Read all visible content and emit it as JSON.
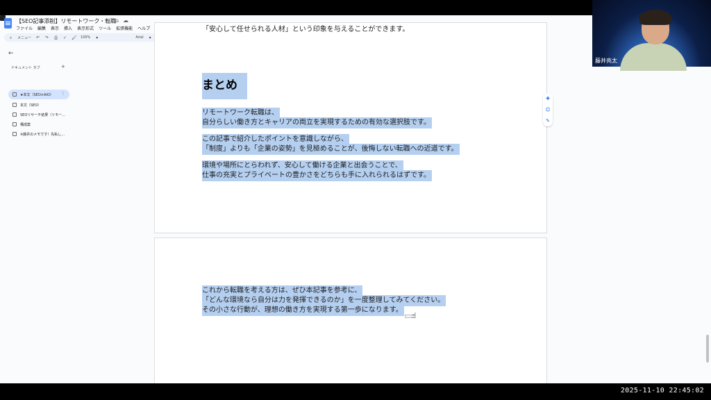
{
  "window": {
    "title": "【SEO記事添削】リモートワーク・転職",
    "menu": [
      "ファイル",
      "編集",
      "表示",
      "挿入",
      "表示形式",
      "ツール",
      "拡張機能",
      "ヘルプ"
    ]
  },
  "toolbar": {
    "menu_search": "メニュー",
    "zoom": "100%",
    "font": "Arial"
  },
  "sidebar": {
    "heading": "ドキュメント タブ",
    "add_tab": "+",
    "tabs": [
      {
        "label": "★本文（SEO×AIO）",
        "active": true
      },
      {
        "label": "本文（SEO）",
        "active": false
      },
      {
        "label": "SEOリサーチ結果（リモー…",
        "active": false
      },
      {
        "label": "構成案",
        "active": false
      },
      {
        "label": "※藤井のメモです！先私し…",
        "active": false
      }
    ]
  },
  "document": {
    "partial_line": "「安心して任せられる人材」という印象を与えることができます。",
    "heading": "まとめ",
    "page1_paragraphs": [
      [
        "リモートワーク転職は、",
        "自分らしい働き方とキャリアの両立を実現するための有効な選択肢です。"
      ],
      [
        "この記事で紹介したポイントを意識しながら、",
        "「制度」よりも「企業の姿勢」を見極めることが、後悔しない転職への近道です。"
      ],
      [
        "環境や場所にとらわれず、安心して働ける企業と出会うことで、",
        "仕事の充実とプライベートの豊かさをどちらも手に入れられるはずです。"
      ]
    ],
    "page2_lines": [
      "これから転職を考える方は、ぜひ本記事を参考に、",
      "「どんな環境なら自分は力を発揮できるのか」を一度整理してみてください。",
      "その小さな行動が、理想の働き方を実現する第一歩になります。"
    ]
  },
  "webcam": {
    "name": "藤井亮太"
  },
  "overlay": {
    "timestamp": "2025-11-10 22:45:02"
  },
  "colors": {
    "selection": "#b4cff0",
    "toolbar_bg": "#edf2fa",
    "active_tab": "#d3e3fd",
    "accent": "#1a73e8"
  }
}
